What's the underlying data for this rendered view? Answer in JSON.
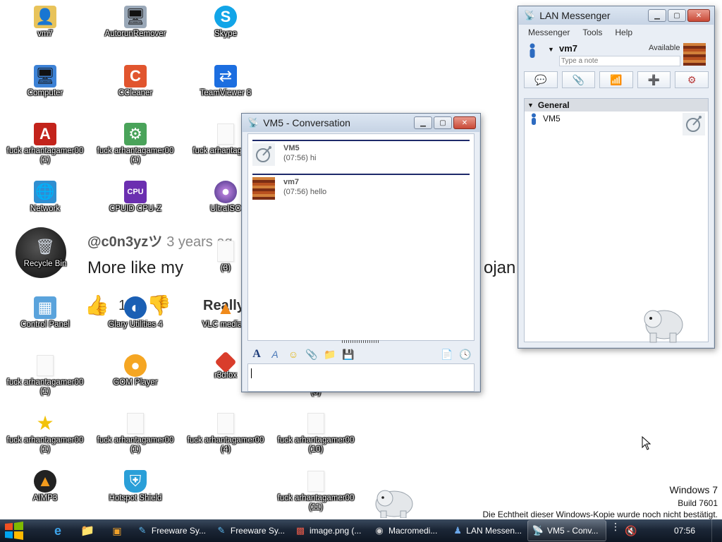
{
  "desktop": {
    "icons": [
      {
        "label": "vm7"
      },
      {
        "label": "AutorunRemover"
      },
      {
        "label": "Skype"
      },
      {
        "label": "Computer"
      },
      {
        "label": "CCleaner"
      },
      {
        "label": "TeamViewer 8"
      },
      {
        "label": "fuck arhantagamer00 (1)"
      },
      {
        "label": "fuck arhantagamer00 (1)"
      },
      {
        "label": "fuck arhantaga (2)"
      },
      {
        "label": "Network"
      },
      {
        "label": "CPUID CPU-Z"
      },
      {
        "label": "UltraISO"
      },
      {
        "label": "Recycle Bin"
      },
      {
        "label": "(3)"
      },
      {
        "label": "Control Panel"
      },
      {
        "label": "Glary Utilities 4"
      },
      {
        "label": "VLC media p"
      },
      {
        "label": "fuck arhantagamer00 (1)"
      },
      {
        "label": "GOM Player"
      },
      {
        "label": "r3dfox"
      },
      {
        "label": "(9)"
      },
      {
        "label": "fuck arhantagamer00 (1)"
      },
      {
        "label": "fuck arhantagamer00 (1)"
      },
      {
        "label": "fuck arhantagamer00 (4)"
      },
      {
        "label": "fuck arhantagamer00 (10)"
      },
      {
        "label": "AIMP3"
      },
      {
        "label": "Hotspot Shield"
      },
      {
        "label": "fuck arhantagamer00 (11)"
      }
    ]
  },
  "wallpaper": {
    "handle": "@c0n3yzツ",
    "ago": "3 years ag",
    "comment_left": "More like my",
    "comment_right": "ojan",
    "likes": "1",
    "really": "Really"
  },
  "conversation_window": {
    "title": "VM5 - Conversation",
    "messages": [
      {
        "sender": "VM5",
        "time": "(07:56)",
        "text": "hi"
      },
      {
        "sender": "vm7",
        "time": "(07:56)",
        "text": "hello"
      }
    ],
    "toolbar_icons": [
      "font-icon",
      "font-color-icon",
      "smiley-icon",
      "attach-file-icon",
      "attach-folder-icon",
      "save-icon",
      "send-file-icon",
      "history-icon"
    ]
  },
  "lan_window": {
    "title": "LAN Messenger",
    "menu": [
      "Messenger",
      "Tools",
      "Help"
    ],
    "user": {
      "name": "vm7",
      "status": "Available",
      "note_placeholder": "Type a note"
    },
    "group": "General",
    "contacts": [
      {
        "name": "VM5"
      }
    ]
  },
  "taskbar": {
    "items": [
      {
        "label": "Freeware Sy...",
        "icon": "freeware-icon"
      },
      {
        "label": "Freeware Sy...",
        "icon": "freeware-icon"
      },
      {
        "label": "image.png (...",
        "icon": "image-icon"
      },
      {
        "label": "Macromedi...",
        "icon": "macromedia-icon"
      },
      {
        "label": "LAN Messen...",
        "icon": "lan-icon"
      },
      {
        "label": "VM5 - Conv...",
        "icon": "conversation-icon"
      }
    ],
    "clock": "07:56"
  },
  "watermark": {
    "os": "Windows 7",
    "build": "Build 7601",
    "notice": "Die Echtheit dieser Windows-Kopie wurde noch nicht bestätigt."
  },
  "colors": {
    "taskbar": "#1b2636",
    "accent": "#1e2a6a",
    "close": "#c94a37"
  }
}
